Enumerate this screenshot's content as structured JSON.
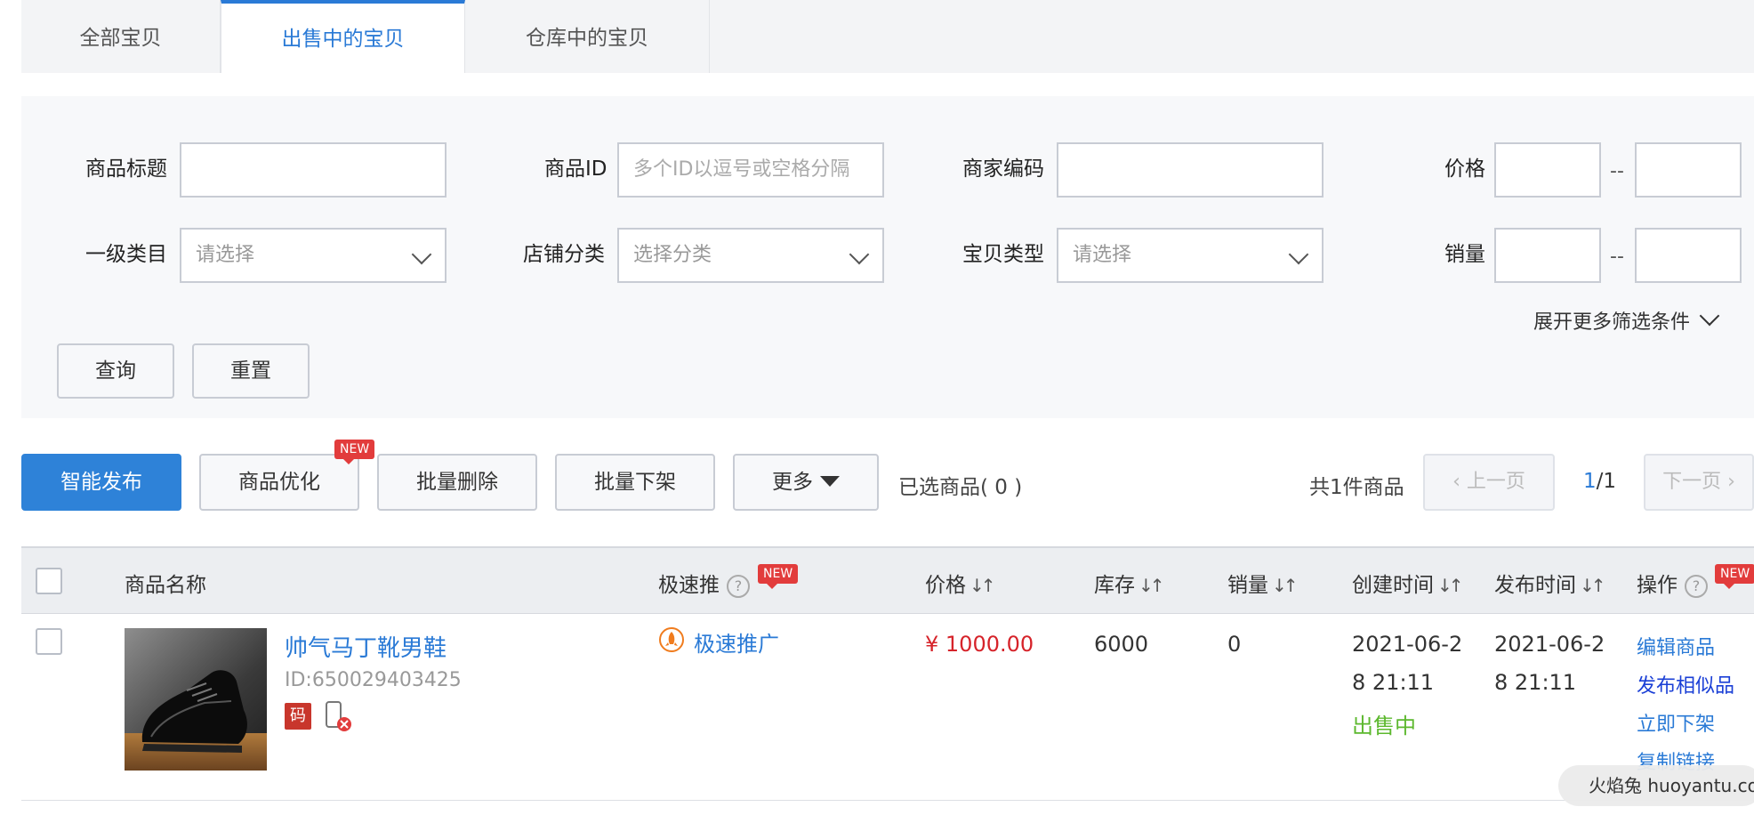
{
  "tabs": [
    {
      "label": "全部宝贝",
      "active": false
    },
    {
      "label": "出售中的宝贝",
      "active": true
    },
    {
      "label": "仓库中的宝贝",
      "active": false
    }
  ],
  "filter": {
    "title_label": "商品标题",
    "title_value": "",
    "id_label": "商品ID",
    "id_placeholder": "多个ID以逗号或空格分隔",
    "code_label": "商家编码",
    "code_value": "",
    "price_label": "价格",
    "range_sep": "--",
    "category_label": "一级类目",
    "category_value": "请选择",
    "shop_cat_label": "店铺分类",
    "shop_cat_value": "选择分类",
    "item_type_label": "宝贝类型",
    "item_type_value": "请选择",
    "sales_label": "销量",
    "expand_label": "展开更多筛选条件",
    "query_button": "查询",
    "reset_button": "重置"
  },
  "toolbar": {
    "publish": "智能发布",
    "optimize": "商品优化",
    "new_badge": "NEW",
    "batch_delete": "批量删除",
    "batch_offline": "批量下架",
    "more": "更多",
    "selected": "已选商品( 0 )",
    "total": "共1件商品",
    "prev": "上一页",
    "next": "下一页",
    "page_current": "1",
    "page_total": "/1"
  },
  "table": {
    "headers": {
      "name": "商品名称",
      "promo": "极速推",
      "price": "价格",
      "stock": "库存",
      "sales": "销量",
      "created": "创建时间",
      "published": "发布时间",
      "actions": "操作"
    },
    "rows": [
      {
        "title": "帅气马丁靴男鞋",
        "id": "ID:650029403425",
        "code_badge": "码",
        "promo": "极速推广",
        "price": "¥ 1000.00",
        "stock": "6000",
        "sales": "0",
        "created_1": "2021-06-2",
        "created_2": "8 21:11",
        "status": "出售中",
        "published_1": "2021-06-2",
        "published_2": "8 21:11",
        "actions": [
          "编辑商品",
          "发布相似品",
          "立即下架",
          "复制链接"
        ]
      }
    ]
  },
  "watermark": "火焰兔 huoyantu.com",
  "colors": {
    "accent": "#2e82d8",
    "price": "#d6232a",
    "status": "#5cb82e",
    "badge": "#e23c3c"
  }
}
